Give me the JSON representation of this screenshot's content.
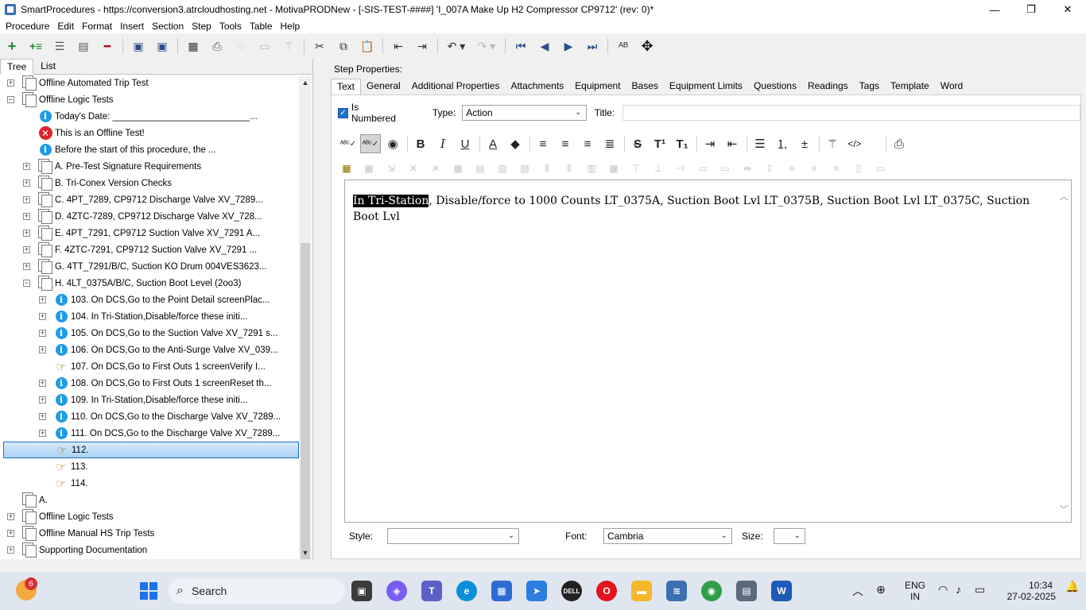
{
  "window": {
    "title": "SmartProcedures - https://conversion3.atrcloudhosting.net - MotivaPRODNew - [-SIS-TEST-####] 'I_007A Make Up H2 Compressor CP9712' (rev: 0)*",
    "minimize": "—",
    "maximize": "❐",
    "close": "✕"
  },
  "menu": [
    "Procedure",
    "Edit",
    "Format",
    "Insert",
    "Section",
    "Step",
    "Tools",
    "Table",
    "Help"
  ],
  "left_tabs": {
    "tree": "Tree",
    "list": "List"
  },
  "tree": [
    {
      "label": "Offline Automated Trip Test",
      "icon": "docs",
      "exp": "+",
      "level": 1
    },
    {
      "label": "Offline Logic Tests",
      "icon": "docs",
      "exp": "−",
      "level": 1
    },
    {
      "label": "Today's Date: ___________________________...",
      "icon": "info",
      "exp": "",
      "level": 2
    },
    {
      "label": "This is an Offline Test!",
      "icon": "error",
      "exp": "",
      "level": 2
    },
    {
      "label": "Before the start of this procedure, the ...",
      "icon": "info",
      "exp": "",
      "level": 2
    },
    {
      "label": "A. Pre-Test Signature Requirements",
      "icon": "docs",
      "exp": "+",
      "level": 2
    },
    {
      "label": "B. Tri-Conex Version Checks",
      "icon": "docs",
      "exp": "+",
      "level": 2
    },
    {
      "label": "C. 4PT_7289, CP9712 Discharge Valve XV_7289...",
      "icon": "docs",
      "exp": "+",
      "level": 2
    },
    {
      "label": "D. 4ZTC-7289, CP9712 Discharge Valve XV_728...",
      "icon": "docs",
      "exp": "+",
      "level": 2
    },
    {
      "label": "E. 4PT_7291, CP9712 Suction Valve XV_7291 A...",
      "icon": "docs",
      "exp": "+",
      "level": 2
    },
    {
      "label": "F. 4ZTC-7291, CP9712 Suction Valve XV_7291 ...",
      "icon": "docs",
      "exp": "+",
      "level": 2
    },
    {
      "label": "G. 4TT_7291/B/C, Suction KO Drum 004VES3623...",
      "icon": "docs",
      "exp": "+",
      "level": 2
    },
    {
      "label": "H. 4LT_0375A/B/C, Suction Boot Level (2oo3)",
      "icon": "docs",
      "exp": "−",
      "level": 2
    },
    {
      "label": "103. On DCS,Go to the Point Detail screenPlac...",
      "icon": "info",
      "exp": "+",
      "level": 3
    },
    {
      "label": "104. In Tri-Station,Disable/force these initi...",
      "icon": "info",
      "exp": "+",
      "level": 3
    },
    {
      "label": "105. On DCS,Go to the Suction Valve XV_7291 s...",
      "icon": "info",
      "exp": "+",
      "level": 3
    },
    {
      "label": "106. On DCS,Go to the Anti-Surge Valve XV_039...",
      "icon": "info",
      "exp": "+",
      "level": 3
    },
    {
      "label": "107. On DCS,Go to First Outs 1 screenVerify I...",
      "icon": "hand",
      "exp": "",
      "level": 3
    },
    {
      "label": "108. On DCS,Go to First Outs 1 screenReset th...",
      "icon": "info",
      "exp": "+",
      "level": 3
    },
    {
      "label": "109. In Tri-Station,Disable/force these initi...",
      "icon": "info",
      "exp": "+",
      "level": 3
    },
    {
      "label": "110. On DCS,Go to the Discharge Valve XV_7289...",
      "icon": "info",
      "exp": "+",
      "level": 3
    },
    {
      "label": "111. On DCS,Go to the Discharge Valve XV_7289...",
      "icon": "info",
      "exp": "+",
      "level": 3
    },
    {
      "label": "112.",
      "icon": "hand",
      "exp": "",
      "level": 3,
      "selected": true
    },
    {
      "label": "113.",
      "icon": "hand",
      "exp": "",
      "level": 3
    },
    {
      "label": "114.",
      "icon": "hand",
      "exp": "",
      "level": 3
    },
    {
      "label": "A.",
      "icon": "docs",
      "exp": "",
      "level": 1
    },
    {
      "label": "Offline Logic Tests",
      "icon": "docs",
      "exp": "+",
      "level": 1
    },
    {
      "label": "Offline Manual HS Trip Tests",
      "icon": "docs",
      "exp": "+",
      "level": 1
    },
    {
      "label": "Supporting Documentation",
      "icon": "docs",
      "exp": "+",
      "level": 1
    }
  ],
  "step_properties": {
    "label": "Step Properties:",
    "tabs": [
      "Text",
      "General",
      "Additional Properties",
      "Attachments",
      "Equipment",
      "Bases",
      "Equipment Limits",
      "Questions",
      "Readings",
      "Tags",
      "Template",
      "Word"
    ],
    "is_numbered_label": "Is Numbered",
    "type_label": "Type:",
    "type_value": "Action",
    "title_label": "Title:",
    "title_value": "",
    "editor_highlight": "In Tri-Station",
    "editor_rest": ", Disable/force to 1000 Counts LT_0375A, Suction Boot Lvl LT_0375B, Suction Boot Lvl LT_0375C, Suction Boot Lvl",
    "style_label": "Style:",
    "style_value": "",
    "font_label": "Font:",
    "font_value": "Cambria",
    "size_label": "Size:",
    "size_value": ""
  },
  "taskbar": {
    "badge": "6",
    "search_placeholder": "Search",
    "lang": "ENG",
    "region": "IN",
    "time": "10:34",
    "date": "27-02-2025"
  }
}
